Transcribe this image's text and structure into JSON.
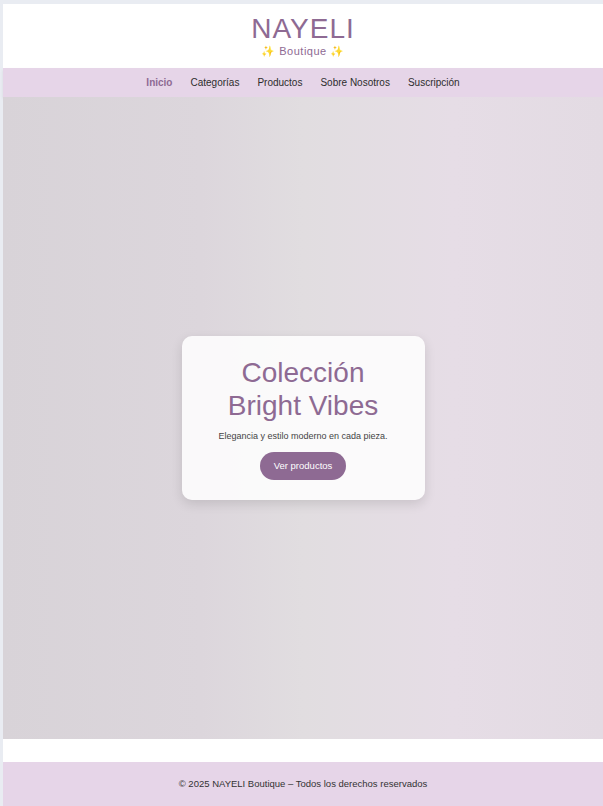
{
  "brand": {
    "name": "NAYELI",
    "tagline": "✨ Boutique ✨"
  },
  "nav": [
    {
      "label": "Inicio",
      "selected": true
    },
    {
      "label": "Categorías",
      "selected": false
    },
    {
      "label": "Productos",
      "selected": false
    },
    {
      "label": "Sobre Nosotros",
      "selected": false
    },
    {
      "label": "Suscripción",
      "selected": false
    }
  ],
  "hero": {
    "title": "Colección Bright Vibes",
    "subtitle": "Elegancia y estilo moderno en cada pieza.",
    "button": "Ver productos"
  },
  "footer": {
    "text": "© 2025 NAYELI Boutique – Todos los derechos reservados"
  }
}
